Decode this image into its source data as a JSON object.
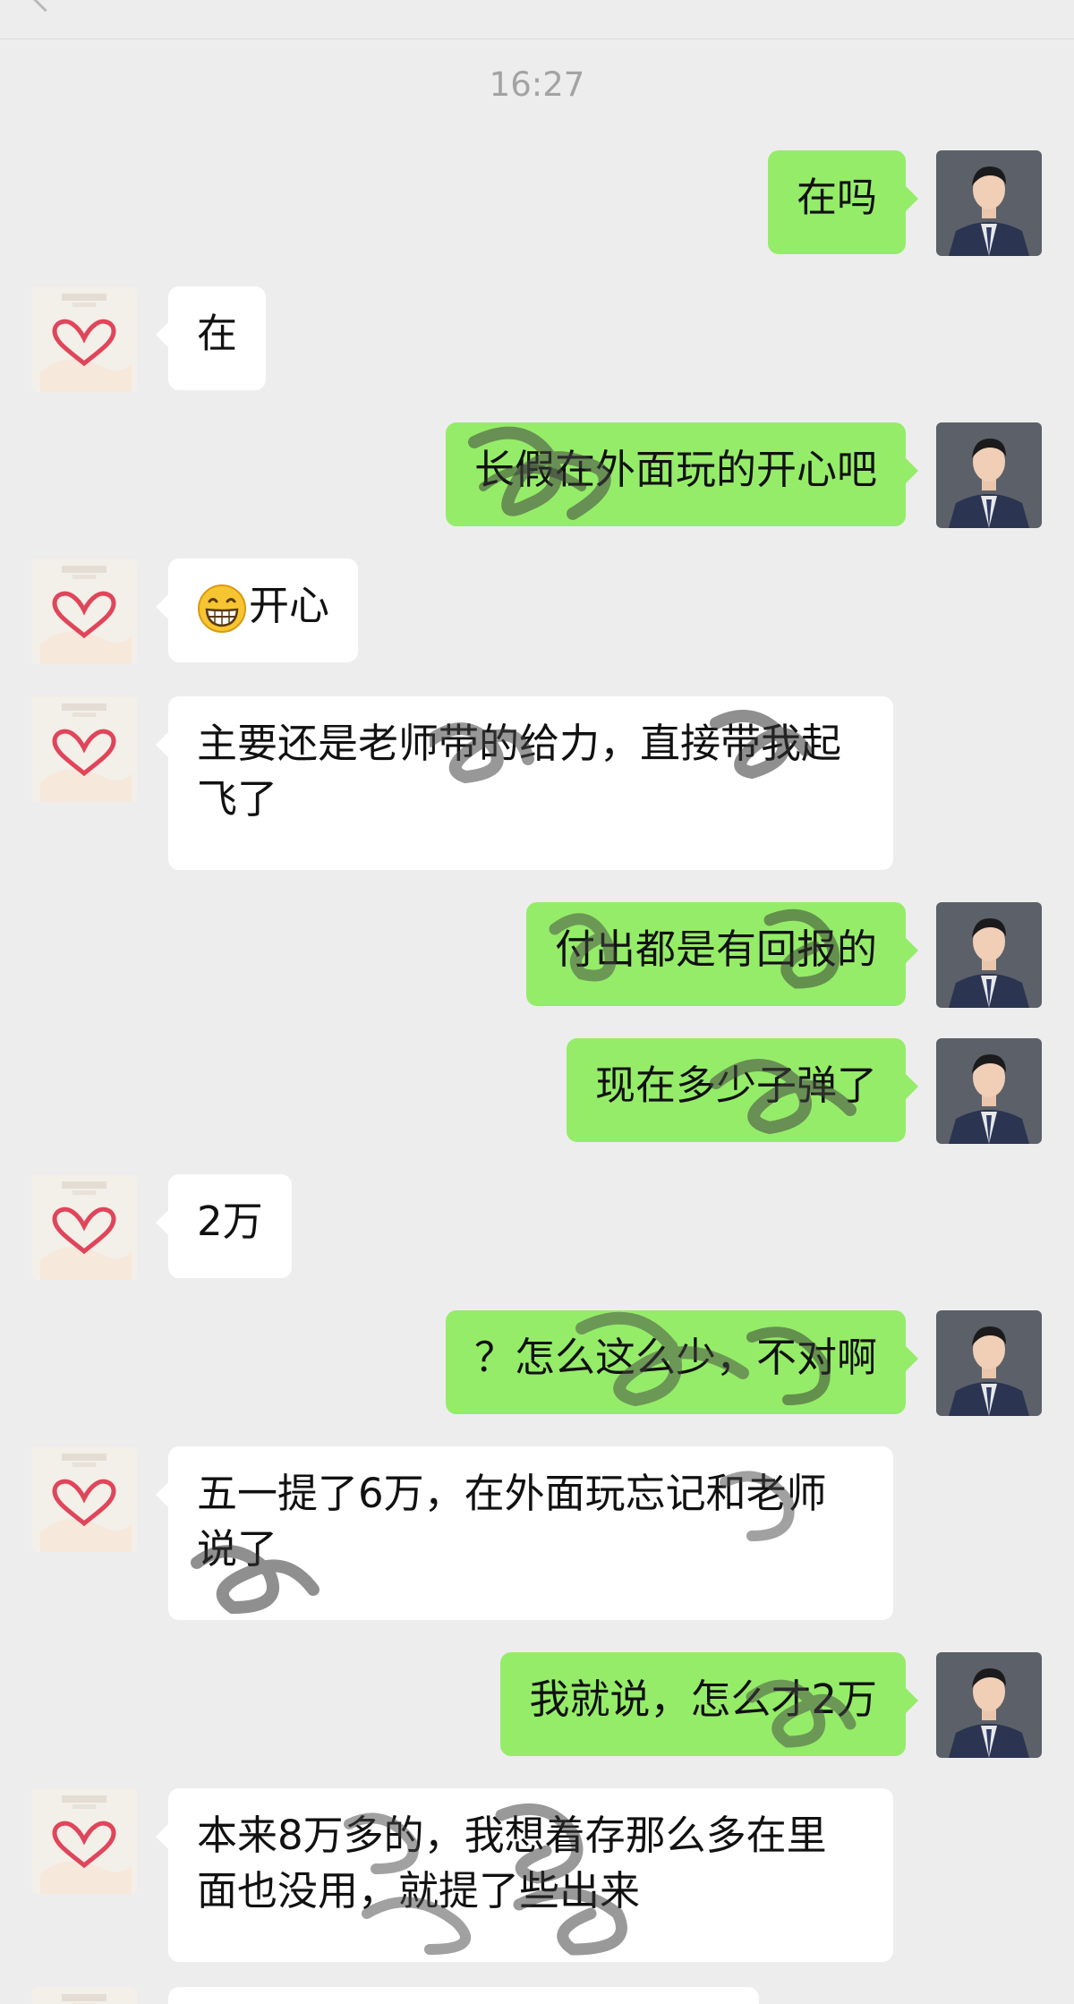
{
  "header": {
    "title": "",
    "back_label": ""
  },
  "timestamp": "16:27",
  "messages": [
    {
      "side": "me",
      "text": "在吗"
    },
    {
      "side": "other",
      "text": "在"
    },
    {
      "side": "me",
      "text": "长假在外面玩的开心吧"
    },
    {
      "side": "other",
      "emoji": "grinning-face",
      "text": "开心"
    },
    {
      "side": "other",
      "text": "主要还是老师带的给力，直接带我起飞了"
    },
    {
      "side": "me",
      "text": "付出都是有回报的"
    },
    {
      "side": "me",
      "text": "现在多少子弹了"
    },
    {
      "side": "other",
      "text": "2万"
    },
    {
      "side": "me",
      "text": "？怎么这么少，不对啊"
    },
    {
      "side": "other",
      "text": "五一提了6万，在外面玩忘记和老师说了"
    },
    {
      "side": "me",
      "text": "我就说，怎么才2万"
    },
    {
      "side": "other",
      "text": "本来8万多的，我想着存那么多在里面也没用，就提了些出来"
    }
  ],
  "colors": {
    "background": "#ededed",
    "my_bubble": "#95ec69",
    "their_bubble": "#ffffff",
    "timestamp": "#a3a3a3"
  },
  "icons": {
    "my_avatar": "man-in-suit-avatar",
    "their_avatar": "heart-hands-avatar"
  }
}
